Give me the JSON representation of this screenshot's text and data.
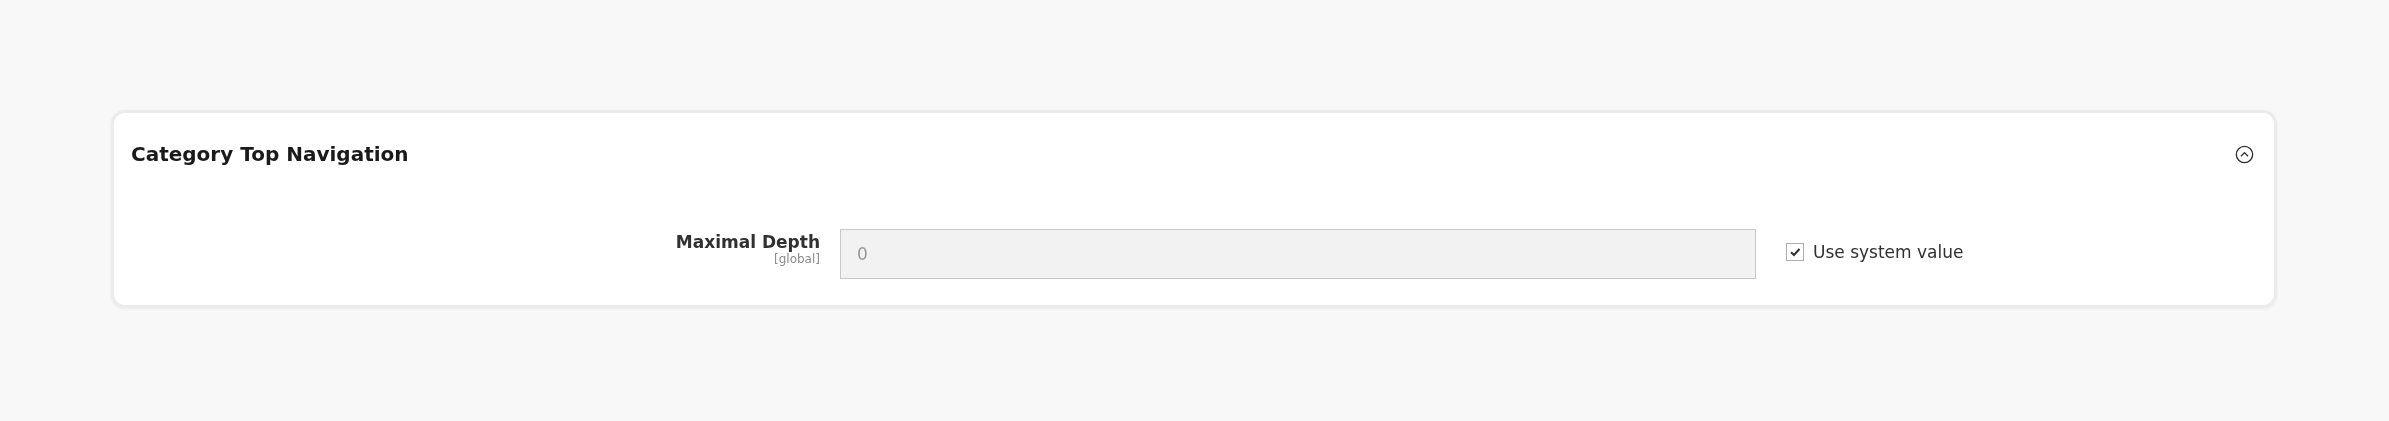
{
  "section": {
    "title": "Category Top Navigation",
    "expanded": true
  },
  "fields": [
    {
      "label": "Maximal Depth",
      "scope": "[global]",
      "value": "0",
      "disabled": true,
      "use_system_value": {
        "label": "Use system value",
        "checked": true
      }
    }
  ]
}
